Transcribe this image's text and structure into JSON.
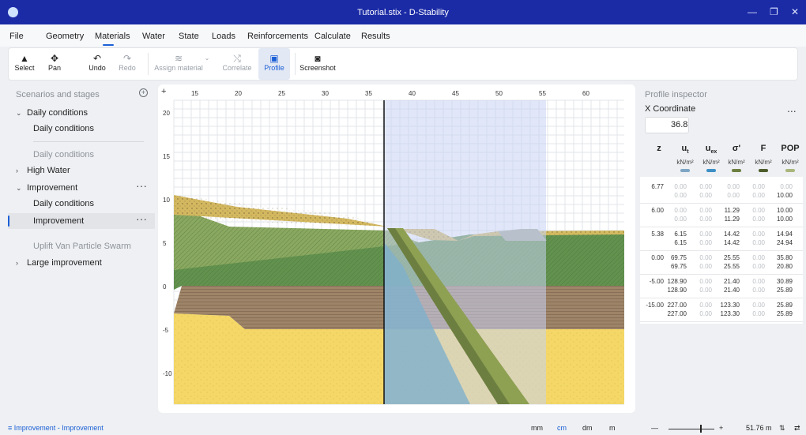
{
  "window": {
    "title": "Tutorial.stix - D-Stability",
    "controls": {
      "minimize": "—",
      "restore": "❐",
      "close": "✕"
    }
  },
  "menu": [
    "File",
    "Geometry",
    "Materials",
    "Water",
    "State",
    "Loads",
    "Reinforcements",
    "Calculate",
    "Results"
  ],
  "toolbar": {
    "select": "Select",
    "pan": "Pan",
    "undo": "Undo",
    "redo": "Redo",
    "assign_material": "Assign material",
    "correlate": "Correlate",
    "profile": "Profile",
    "screenshot": "Screenshot"
  },
  "sidebar": {
    "title": "Scenarios and stages",
    "daily_conditions": "Daily conditions",
    "daily_conditions_stage": "Daily conditions",
    "daily_conditions_muted": "Daily conditions",
    "high_water": "High Water",
    "improvement": "Improvement",
    "improvement_daily": "Daily conditions",
    "improvement_selected": "Improvement",
    "uplift": "Uplift Van Particle Swarm",
    "large_improvement": "Large improvement"
  },
  "canvas": {
    "x_ticks": [
      "15",
      "20",
      "25",
      "30",
      "35",
      "40",
      "45",
      "50",
      "55",
      "60"
    ],
    "y_ticks": [
      "20",
      "15",
      "10",
      "5",
      "0",
      "-5",
      "-10"
    ],
    "corner_plus": "+"
  },
  "inspector": {
    "title": "Profile inspector",
    "x_label": "X Coordinate",
    "x_value": "36.8",
    "more": "...",
    "columns": [
      {
        "name": "z",
        "sub": "",
        "unit": "",
        "swatch": ""
      },
      {
        "name": "u",
        "sub": "t",
        "unit": "kN/m²",
        "swatch": "#7ea6c4"
      },
      {
        "name": "u",
        "sub": "ex",
        "unit": "kN/m²",
        "swatch": "#3d8fc6"
      },
      {
        "name": "σ'",
        "sub": "",
        "unit": "kN/m²",
        "swatch": "#6d7f40"
      },
      {
        "name": "F",
        "sub": "",
        "unit": "kN/m²",
        "swatch": "#4d5c2a"
      },
      {
        "name": "POP",
        "sub": "",
        "unit": "kN/m²",
        "swatch": "#a9b77c"
      }
    ],
    "rows": [
      {
        "z": "6.77",
        "a": [
          "0.00",
          "0.00",
          "0.00",
          "0.00",
          "0.00"
        ],
        "b": [
          "0.00",
          "0.00",
          "0.00",
          "0.00",
          "10.00"
        ]
      },
      {
        "z": "6.00",
        "a": [
          "0.00",
          "0.00",
          "11.29",
          "0.00",
          "10.00"
        ],
        "b": [
          "0.00",
          "0.00",
          "11.29",
          "0.00",
          "10.00"
        ]
      },
      {
        "z": "5.38",
        "a": [
          "6.15",
          "0.00",
          "14.42",
          "0.00",
          "14.94"
        ],
        "b": [
          "6.15",
          "0.00",
          "14.42",
          "0.00",
          "24.94"
        ]
      },
      {
        "z": "0.00",
        "a": [
          "69.75",
          "0.00",
          "25.55",
          "0.00",
          "35.80"
        ],
        "b": [
          "69.75",
          "0.00",
          "25.55",
          "0.00",
          "20.80"
        ]
      },
      {
        "z": "-5.00",
        "a": [
          "128.90",
          "0.00",
          "21.40",
          "0.00",
          "30.89"
        ],
        "b": [
          "128.90",
          "0.00",
          "21.40",
          "0.00",
          "25.89"
        ]
      },
      {
        "z": "-15.00",
        "a": [
          "227.00",
          "0.00",
          "123.30",
          "0.00",
          "25.89"
        ],
        "b": [
          "227.00",
          "0.00",
          "123.30",
          "0.00",
          "25.89"
        ]
      }
    ]
  },
  "status": {
    "breadcrumb": "Improvement - Improvement",
    "units": [
      "mm",
      "cm",
      "dm",
      "m"
    ],
    "active_unit": "cm",
    "zoom_minus": "—",
    "zoom_plus": "+",
    "scale": "51.76 m",
    "sort_icon": "⇅",
    "swap_icon": "⇄"
  },
  "colors": {
    "titlebar": "#1b2ba6",
    "accent": "#1b5fd6",
    "sand": "#f3d96b",
    "clay_green": "#5f8f4e",
    "peat_brown": "#9b7f62",
    "water": "#8fb6d6",
    "selection": "#c8d4f4"
  }
}
